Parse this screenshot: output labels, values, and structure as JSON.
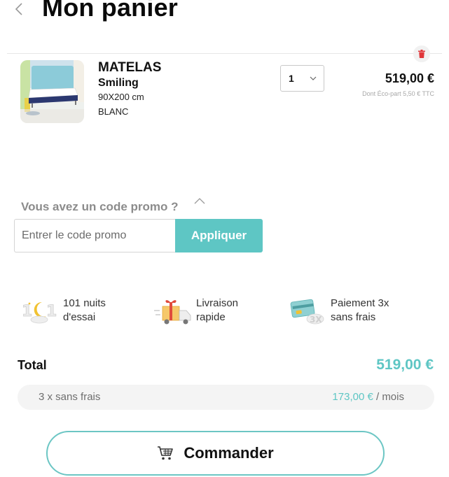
{
  "header": {
    "title": "Mon panier",
    "back_icon": "chevron-left-icon"
  },
  "cart": {
    "items": [
      {
        "name": "MATELAS",
        "model": "Smiling",
        "size": "90X200 cm",
        "color": "BLANC",
        "quantity": "1",
        "price": "519,00 €",
        "ecopart": "Dont Éco-part 5,50 € TTC",
        "thumb_icon": "mattress-product-image",
        "delete_icon": "trash-icon"
      }
    ]
  },
  "promo": {
    "question": "Vous avez un code promo ?",
    "placeholder": "Entrer le code promo",
    "value": "",
    "apply_label": "Appliquer"
  },
  "features": [
    {
      "icon": "moon-101-nights-icon",
      "line1": "101 nuits",
      "line2": "d'essai"
    },
    {
      "icon": "gift-truck-icon",
      "line1": "Livraison",
      "line2": "rapide"
    },
    {
      "icon": "credit-card-3x-icon",
      "line1": "Paiement 3x",
      "line2": "sans frais"
    }
  ],
  "summary": {
    "total_label": "Total",
    "total_value": "519,00 €",
    "installment_label": "3 x sans frais",
    "installment_amount": "173,00 €",
    "installment_suffix": " / mois"
  },
  "checkout": {
    "label": "Commander",
    "icon": "cart-icon"
  },
  "colors": {
    "accent": "#5ec6c4",
    "text": "#111111",
    "muted": "#8c8c8c",
    "delete": "#e0363a"
  }
}
